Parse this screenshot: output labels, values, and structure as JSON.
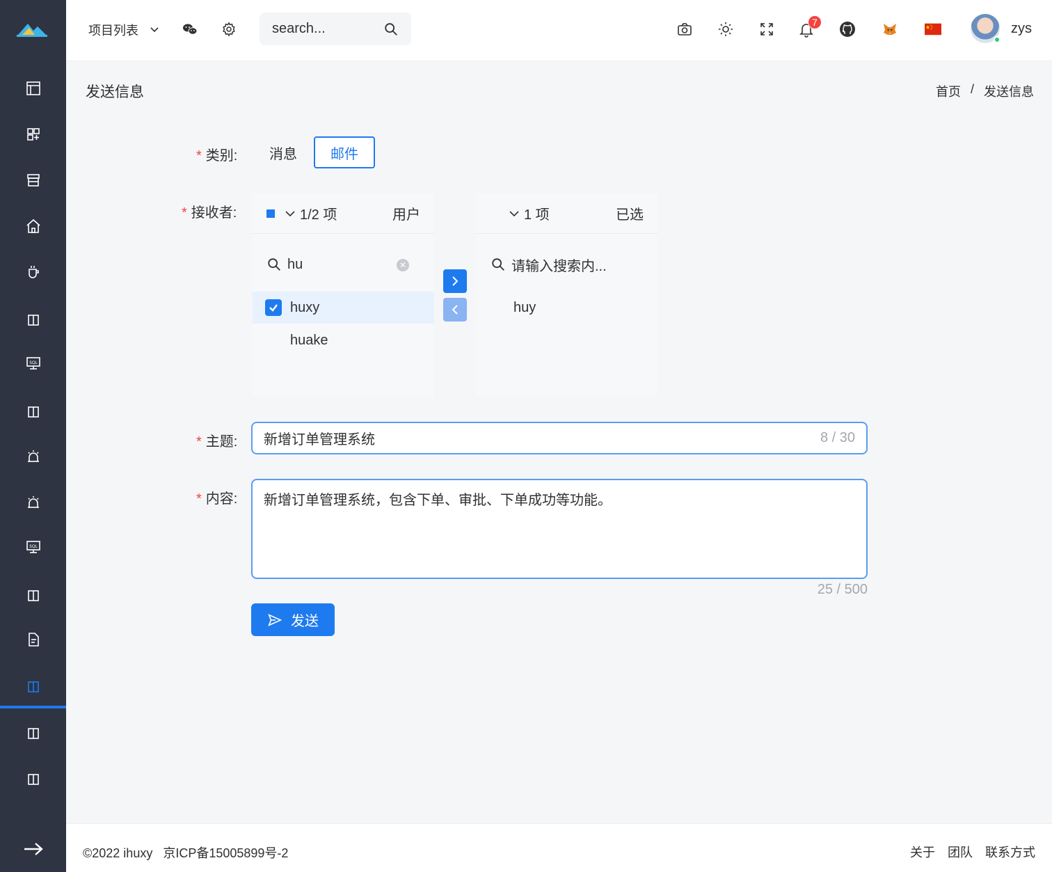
{
  "header": {
    "project_select": "项目列表",
    "search_placeholder": "search...",
    "notification_count": "7",
    "username": "zys"
  },
  "page": {
    "title": "发送信息",
    "breadcrumb": [
      "首页",
      "/",
      "发送信息"
    ]
  },
  "form": {
    "category_label": "类别:",
    "category_options": [
      "消息",
      "邮件"
    ],
    "category_selected": "邮件",
    "receiver_label": "接收者:",
    "left_panel": {
      "count": "1/2 项",
      "title": "用户",
      "search_value": "hu",
      "items": [
        {
          "label": "huxy",
          "checked": true
        },
        {
          "label": "huake",
          "checked": false
        }
      ]
    },
    "right_panel": {
      "count": "1 项",
      "title": "已选",
      "search_placeholder": "请输入搜索内...",
      "items": [
        "huy"
      ]
    },
    "subject_label": "主题:",
    "subject_value": "新增订单管理系统",
    "subject_counter": "8 / 30",
    "content_label": "内容:",
    "content_value": "新增订单管理系统，包含下单、审批、下单成功等功能。",
    "content_counter": "25 / 500",
    "send_label": "发送"
  },
  "footer": {
    "copyright": "©2022 ihuxy",
    "icp": "京ICP备15005899号-2",
    "links": [
      "关于",
      "团队",
      "联系方式"
    ]
  },
  "colors": {
    "primary": "#1e7bef",
    "sidebar": "#2e3442",
    "required": "#f5433e"
  }
}
